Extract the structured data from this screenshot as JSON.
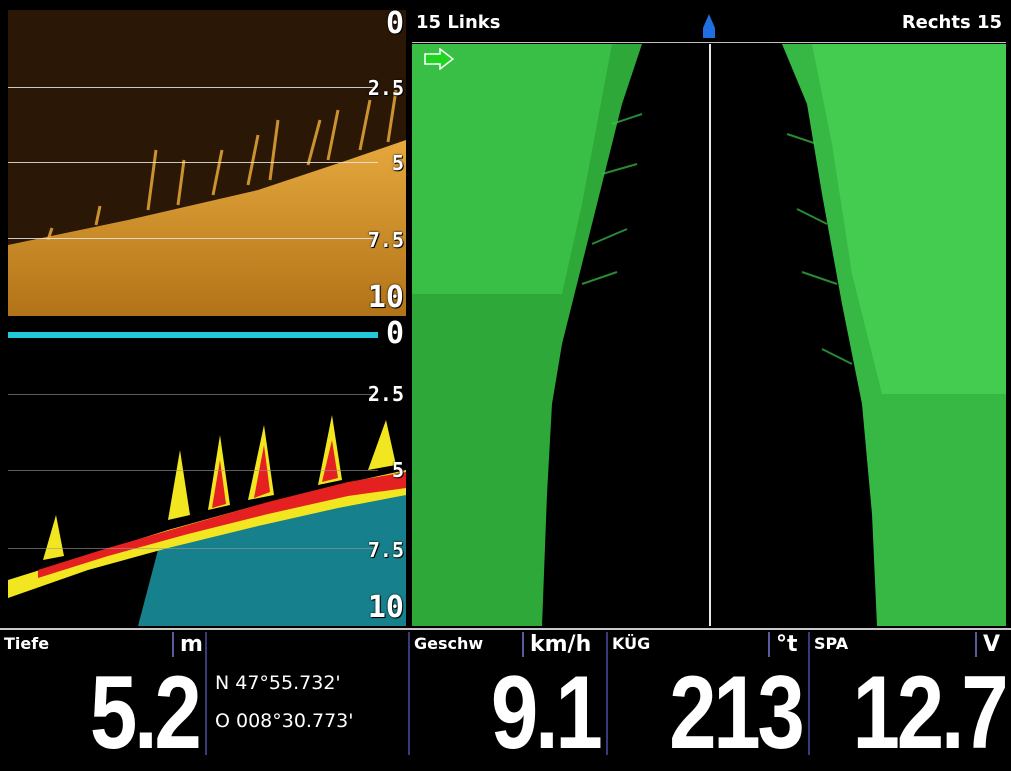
{
  "side_imaging": {
    "left_label": "15 Links",
    "right_label": "Rechts 15"
  },
  "down_view": {
    "scale": [
      "0",
      "2.5",
      "5",
      "7.5",
      "10"
    ]
  },
  "twod_view": {
    "scale": [
      "0",
      "2.5",
      "5",
      "7.5",
      "10"
    ]
  },
  "data_boxes": {
    "depth": {
      "label": "Tiefe",
      "unit": "m",
      "value": "5.2"
    },
    "position": {
      "lat": "N 47°55.732'",
      "lon": "O 008°30.773'"
    },
    "speed": {
      "label": "Geschw",
      "unit": "km/h",
      "value": "9.1"
    },
    "course": {
      "label": "KÜG",
      "unit": "°t",
      "value": "213"
    },
    "voltage": {
      "label": "SPA",
      "unit": "V",
      "value": "12.7"
    }
  },
  "colors": {
    "side_scan": "#33c43a",
    "down_scan": "#d69a2a",
    "surface_line": "#20c8d8",
    "separator": "#3a3a78"
  }
}
